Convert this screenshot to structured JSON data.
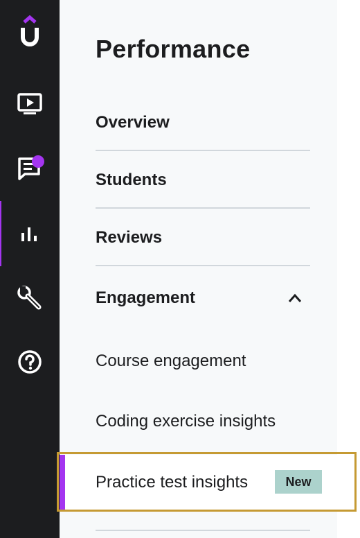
{
  "sidebar_rail": {
    "items": [
      {
        "icon": "udemy-logo-icon"
      },
      {
        "icon": "video-icon"
      },
      {
        "icon": "chat-icon",
        "notification": true
      },
      {
        "icon": "bar-chart-icon",
        "active": true
      },
      {
        "icon": "wrench-icon"
      },
      {
        "icon": "help-icon"
      }
    ],
    "accent_color": "#a435f0"
  },
  "panel": {
    "title": "Performance",
    "items": [
      {
        "label": "Overview"
      },
      {
        "label": "Students"
      },
      {
        "label": "Reviews"
      },
      {
        "label": "Engagement",
        "expanded": true
      }
    ],
    "engagement_children": [
      {
        "label": "Course engagement"
      },
      {
        "label": "Coding exercise insights"
      },
      {
        "label": "Practice test insights",
        "badge": "New",
        "selected": true
      }
    ]
  },
  "colors": {
    "rail_background": "#1c1d1f",
    "panel_background": "#f7f9fa",
    "accent": "#a435f0",
    "badge_background": "#acd2cc",
    "highlight_border": "#c59a33"
  }
}
